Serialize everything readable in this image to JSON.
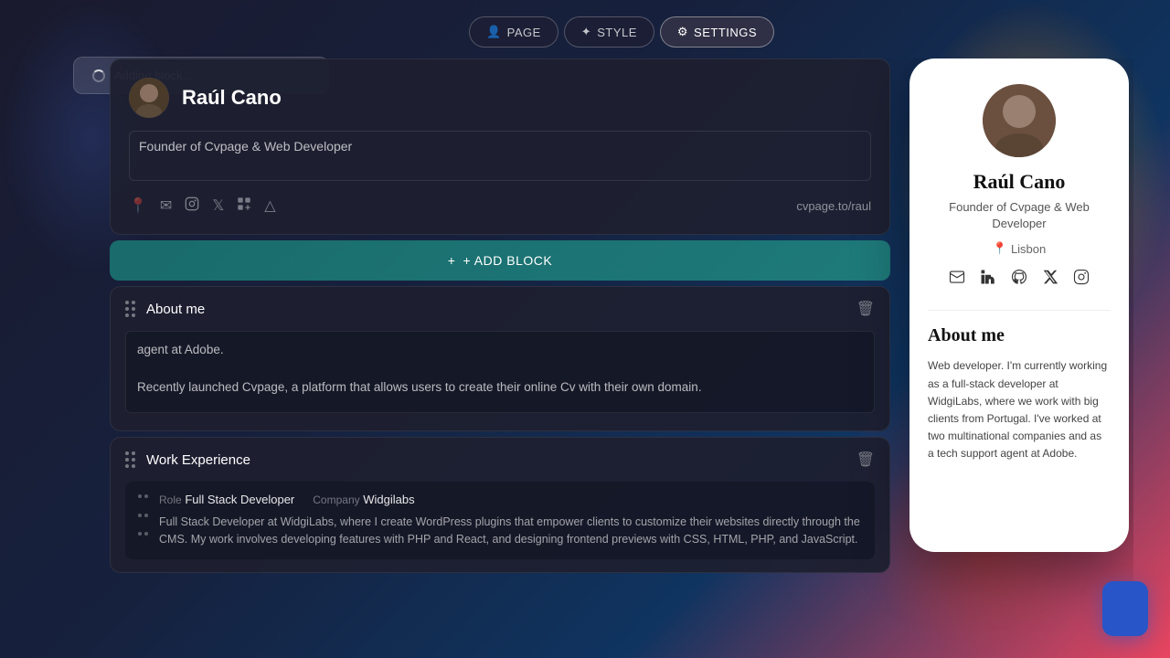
{
  "background": {
    "color": "#1a1a2e"
  },
  "nav": {
    "page_label": "PAGE",
    "style_label": "STYLE",
    "settings_label": "SETTINGS"
  },
  "toast": {
    "message": "Adding block..."
  },
  "editor": {
    "profile": {
      "name": "Raúl Cano",
      "bio": "Founder of Cvpage & Web Developer",
      "url": "cvpage.to/raul",
      "social_icons": [
        "📍",
        "✉",
        "📷",
        "𝕏",
        "in",
        "△"
      ]
    },
    "add_block_label": "+ ADD BLOCK",
    "sections": [
      {
        "id": "about",
        "title": "About me",
        "content": "agent at Adobe.\n\nRecently launched Cvpage, a platform that allows users to create their online Cv with their own domain."
      },
      {
        "id": "work",
        "title": "Work Experience",
        "entries": [
          {
            "role_label": "Role",
            "role": "Full Stack Developer",
            "company_label": "Company",
            "company": "Widgilabs",
            "description": "Full Stack Developer at WidgiLabs, where I create WordPress plugins that empower clients to customize their websites directly through the CMS. My work involves developing features with PHP and React, and designing frontend previews with CSS, HTML, PHP, and JavaScript."
          }
        ]
      }
    ]
  },
  "preview": {
    "name": "Raúl  Cano",
    "title": "Founder of Cvpage & Web\nDeveloper",
    "location": "Lisbon",
    "about_title": "About me",
    "about_text": "Web developer. I'm currently working as a full-stack developer at WidgiLabs, where we work with big clients from Portugal. I've worked at two multinational companies and as a tech support agent at Adobe."
  }
}
